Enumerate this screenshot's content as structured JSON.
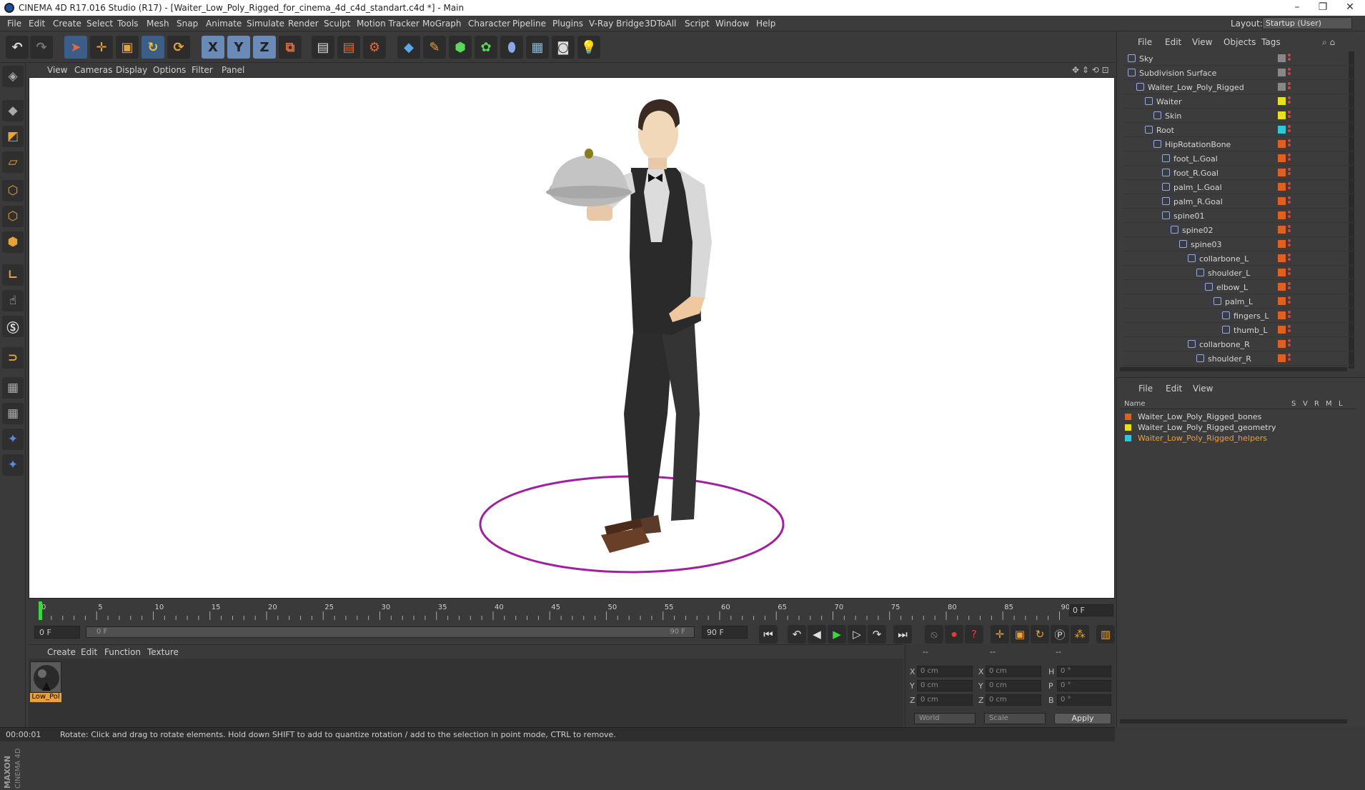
{
  "window": {
    "title": "CINEMA 4D R17.016 Studio (R17) - [Waiter_Low_Poly_Rigged_for_cinema_4d_c4d_standart.c4d *] - Main",
    "minimize": "–",
    "restore": "❐",
    "close": "✕"
  },
  "menubar": {
    "items": [
      "File",
      "Edit",
      "Create",
      "Select",
      "Tools",
      "Mesh",
      "Snap",
      "Animate",
      "Simulate",
      "Render",
      "Sculpt",
      "Motion Tracker",
      "MoGraph",
      "Character",
      "Pipeline",
      "Plugins",
      "V-Ray Bridge",
      "3DToAll",
      "Script",
      "Window",
      "Help"
    ],
    "layout_label": "Layout:",
    "layout_value": "Startup (User)"
  },
  "toolbar": {
    "axis_x": "X",
    "axis_y": "Y",
    "axis_z": "Z"
  },
  "viewport": {
    "menu": [
      "View",
      "Cameras",
      "Display",
      "Options",
      "Filter",
      "Panel"
    ]
  },
  "timeline": {
    "ticks": [
      "0",
      "5",
      "10",
      "15",
      "20",
      "25",
      "30",
      "35",
      "40",
      "45",
      "50",
      "55",
      "60",
      "65",
      "70",
      "75",
      "80",
      "85",
      "90"
    ],
    "current_frame": "0 F"
  },
  "transport": {
    "start_field": "0 F",
    "range_start": "0 F",
    "range_end": "90 F",
    "end_field": "90 F"
  },
  "material_manager": {
    "menu": [
      "Create",
      "Edit",
      "Function",
      "Texture"
    ],
    "material_name": "Low_Pol"
  },
  "coordinates": {
    "header_dashes": [
      "--",
      "--",
      "--"
    ],
    "rows": [
      {
        "l1": "X",
        "v1": "0 cm",
        "l2": "X",
        "v2": "0 cm",
        "l3": "H",
        "v3": "0 °"
      },
      {
        "l1": "Y",
        "v1": "0 cm",
        "l2": "Y",
        "v2": "0 cm",
        "l3": "P",
        "v3": "0 °"
      },
      {
        "l1": "Z",
        "v1": "0 cm",
        "l2": "Z",
        "v2": "0 cm",
        "l3": "B",
        "v3": "0 °"
      }
    ],
    "mode": "World",
    "transform": "Scale",
    "apply": "Apply"
  },
  "status": {
    "time": "00:00:01",
    "message": "Rotate: Click and drag to rotate elements. Hold down SHIFT to add to quantize rotation / add to the selection in point mode, CTRL to remove."
  },
  "object_manager": {
    "menu": [
      "File",
      "Edit",
      "View",
      "Objects",
      "Tags"
    ],
    "objects": [
      {
        "name": "Sky",
        "color": "#888888",
        "indent": 0
      },
      {
        "name": "Subdivision Surface",
        "color": "#888888",
        "indent": 0
      },
      {
        "name": "Waiter_Low_Poly_Rigged",
        "color": "#888888",
        "indent": 1
      },
      {
        "name": "Waiter",
        "color": "#e8e020",
        "indent": 2
      },
      {
        "name": "Skin",
        "color": "#e8e020",
        "indent": 3
      },
      {
        "name": "Root",
        "color": "#30c8d8",
        "indent": 2
      },
      {
        "name": "HipRotationBone",
        "color": "#e06020",
        "indent": 3
      },
      {
        "name": "foot_L.Goal",
        "color": "#e06020",
        "indent": 4
      },
      {
        "name": "foot_R.Goal",
        "color": "#e06020",
        "indent": 4
      },
      {
        "name": "palm_L.Goal",
        "color": "#e06020",
        "indent": 4
      },
      {
        "name": "palm_R.Goal",
        "color": "#e06020",
        "indent": 4
      },
      {
        "name": "spine01",
        "color": "#e06020",
        "indent": 4
      },
      {
        "name": "spine02",
        "color": "#e06020",
        "indent": 5
      },
      {
        "name": "spine03",
        "color": "#e06020",
        "indent": 6
      },
      {
        "name": "collarbone_L",
        "color": "#e06020",
        "indent": 7
      },
      {
        "name": "shoulder_L",
        "color": "#e06020",
        "indent": 8
      },
      {
        "name": "elbow_L",
        "color": "#e06020",
        "indent": 9
      },
      {
        "name": "palm_L",
        "color": "#e06020",
        "indent": 10
      },
      {
        "name": "fingers_L",
        "color": "#e06020",
        "indent": 11
      },
      {
        "name": "thumb_L",
        "color": "#e06020",
        "indent": 11
      },
      {
        "name": "collarbone_R",
        "color": "#e06020",
        "indent": 7
      },
      {
        "name": "shoulder_R",
        "color": "#e06020",
        "indent": 8
      }
    ]
  },
  "layer_manager": {
    "menu": [
      "File",
      "Edit",
      "View"
    ],
    "columns": {
      "name": "Name",
      "s": "S",
      "v": "V",
      "r": "R",
      "m": "M",
      "l": "L"
    },
    "layers": [
      {
        "name": "Waiter_Low_Poly_Rigged_bones",
        "color": "#e06020",
        "text_color": "#d8d8d8"
      },
      {
        "name": "Waiter_Low_Poly_Rigged_geometry",
        "color": "#e8e020",
        "text_color": "#d8d8d8"
      },
      {
        "name": "Waiter_Low_Poly_Rigged_helpers",
        "color": "#30c8d8",
        "text_color": "#e8a23a"
      }
    ]
  }
}
